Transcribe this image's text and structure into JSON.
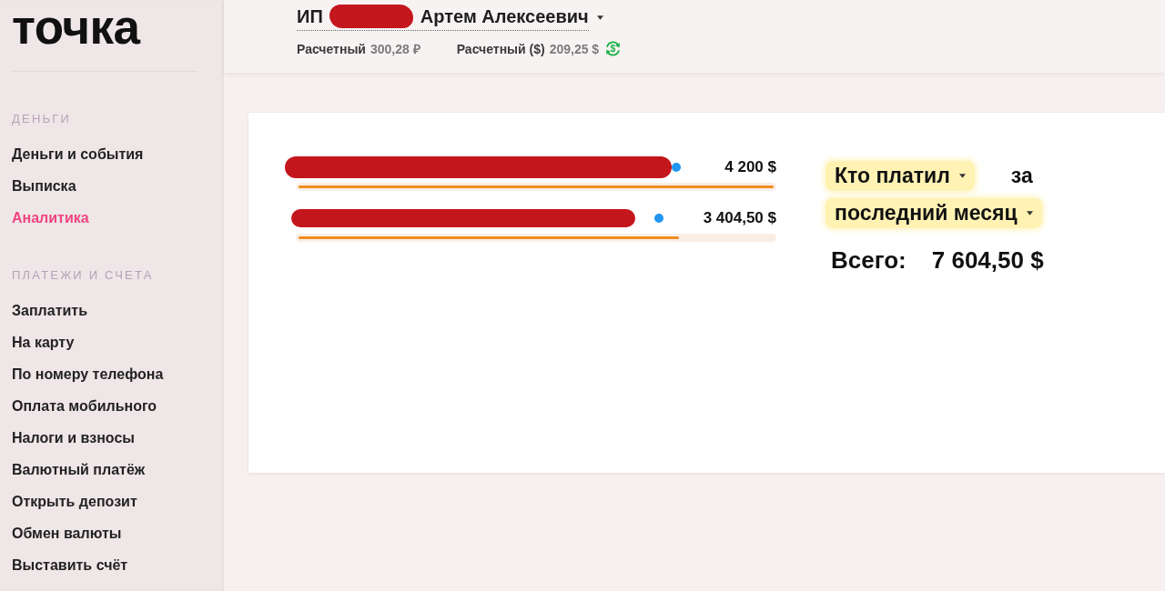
{
  "sidebar": {
    "logo": "точка",
    "sections": [
      {
        "title": "ДЕНЬГИ",
        "items": [
          {
            "label": "Деньги и события",
            "selected": false
          },
          {
            "label": "Выписка",
            "selected": false
          },
          {
            "label": "Аналитика",
            "selected": true
          }
        ]
      },
      {
        "title": "ПЛАТЕЖИ И СЧЕТА",
        "items": [
          {
            "label": "Заплатить",
            "selected": false
          },
          {
            "label": "На карту",
            "selected": false
          },
          {
            "label": "По номеру телефона",
            "selected": false
          },
          {
            "label": "Оплата мобильного",
            "selected": false
          },
          {
            "label": "Налоги и взносы",
            "selected": false
          },
          {
            "label": "Валютный платёж",
            "selected": false
          },
          {
            "label": "Открыть депозит",
            "selected": false
          },
          {
            "label": "Обмен валюты",
            "selected": false
          },
          {
            "label": "Выставить счёт",
            "selected": false
          }
        ]
      }
    ]
  },
  "header": {
    "owner": {
      "prefix": "ИП",
      "redacted": true,
      "name": "Артем Алексеевич"
    },
    "accounts": [
      {
        "name": "Расчетный",
        "balance": "300,28 ₽",
        "exchange": false
      },
      {
        "name": "Расчетный ($)",
        "balance": "209,25 $",
        "exchange": true,
        "exchange_glyph": "$"
      }
    ]
  },
  "payers": {
    "rows": [
      {
        "redacted": true,
        "color": "#2196f3",
        "amount": "4 200 $",
        "level": 1
      },
      {
        "redacted": true,
        "color": "#2196f3",
        "amount": "3 404,50 $",
        "level": 0.8
      }
    ],
    "filters": [
      {
        "kind": "dropdown",
        "label": "Кто платил"
      },
      {
        "kind": "text",
        "label": "за"
      },
      {
        "kind": "dropdown",
        "label": "последний месяц"
      }
    ],
    "total": {
      "label": "Всего:",
      "value": "7 604,50 $"
    }
  }
}
